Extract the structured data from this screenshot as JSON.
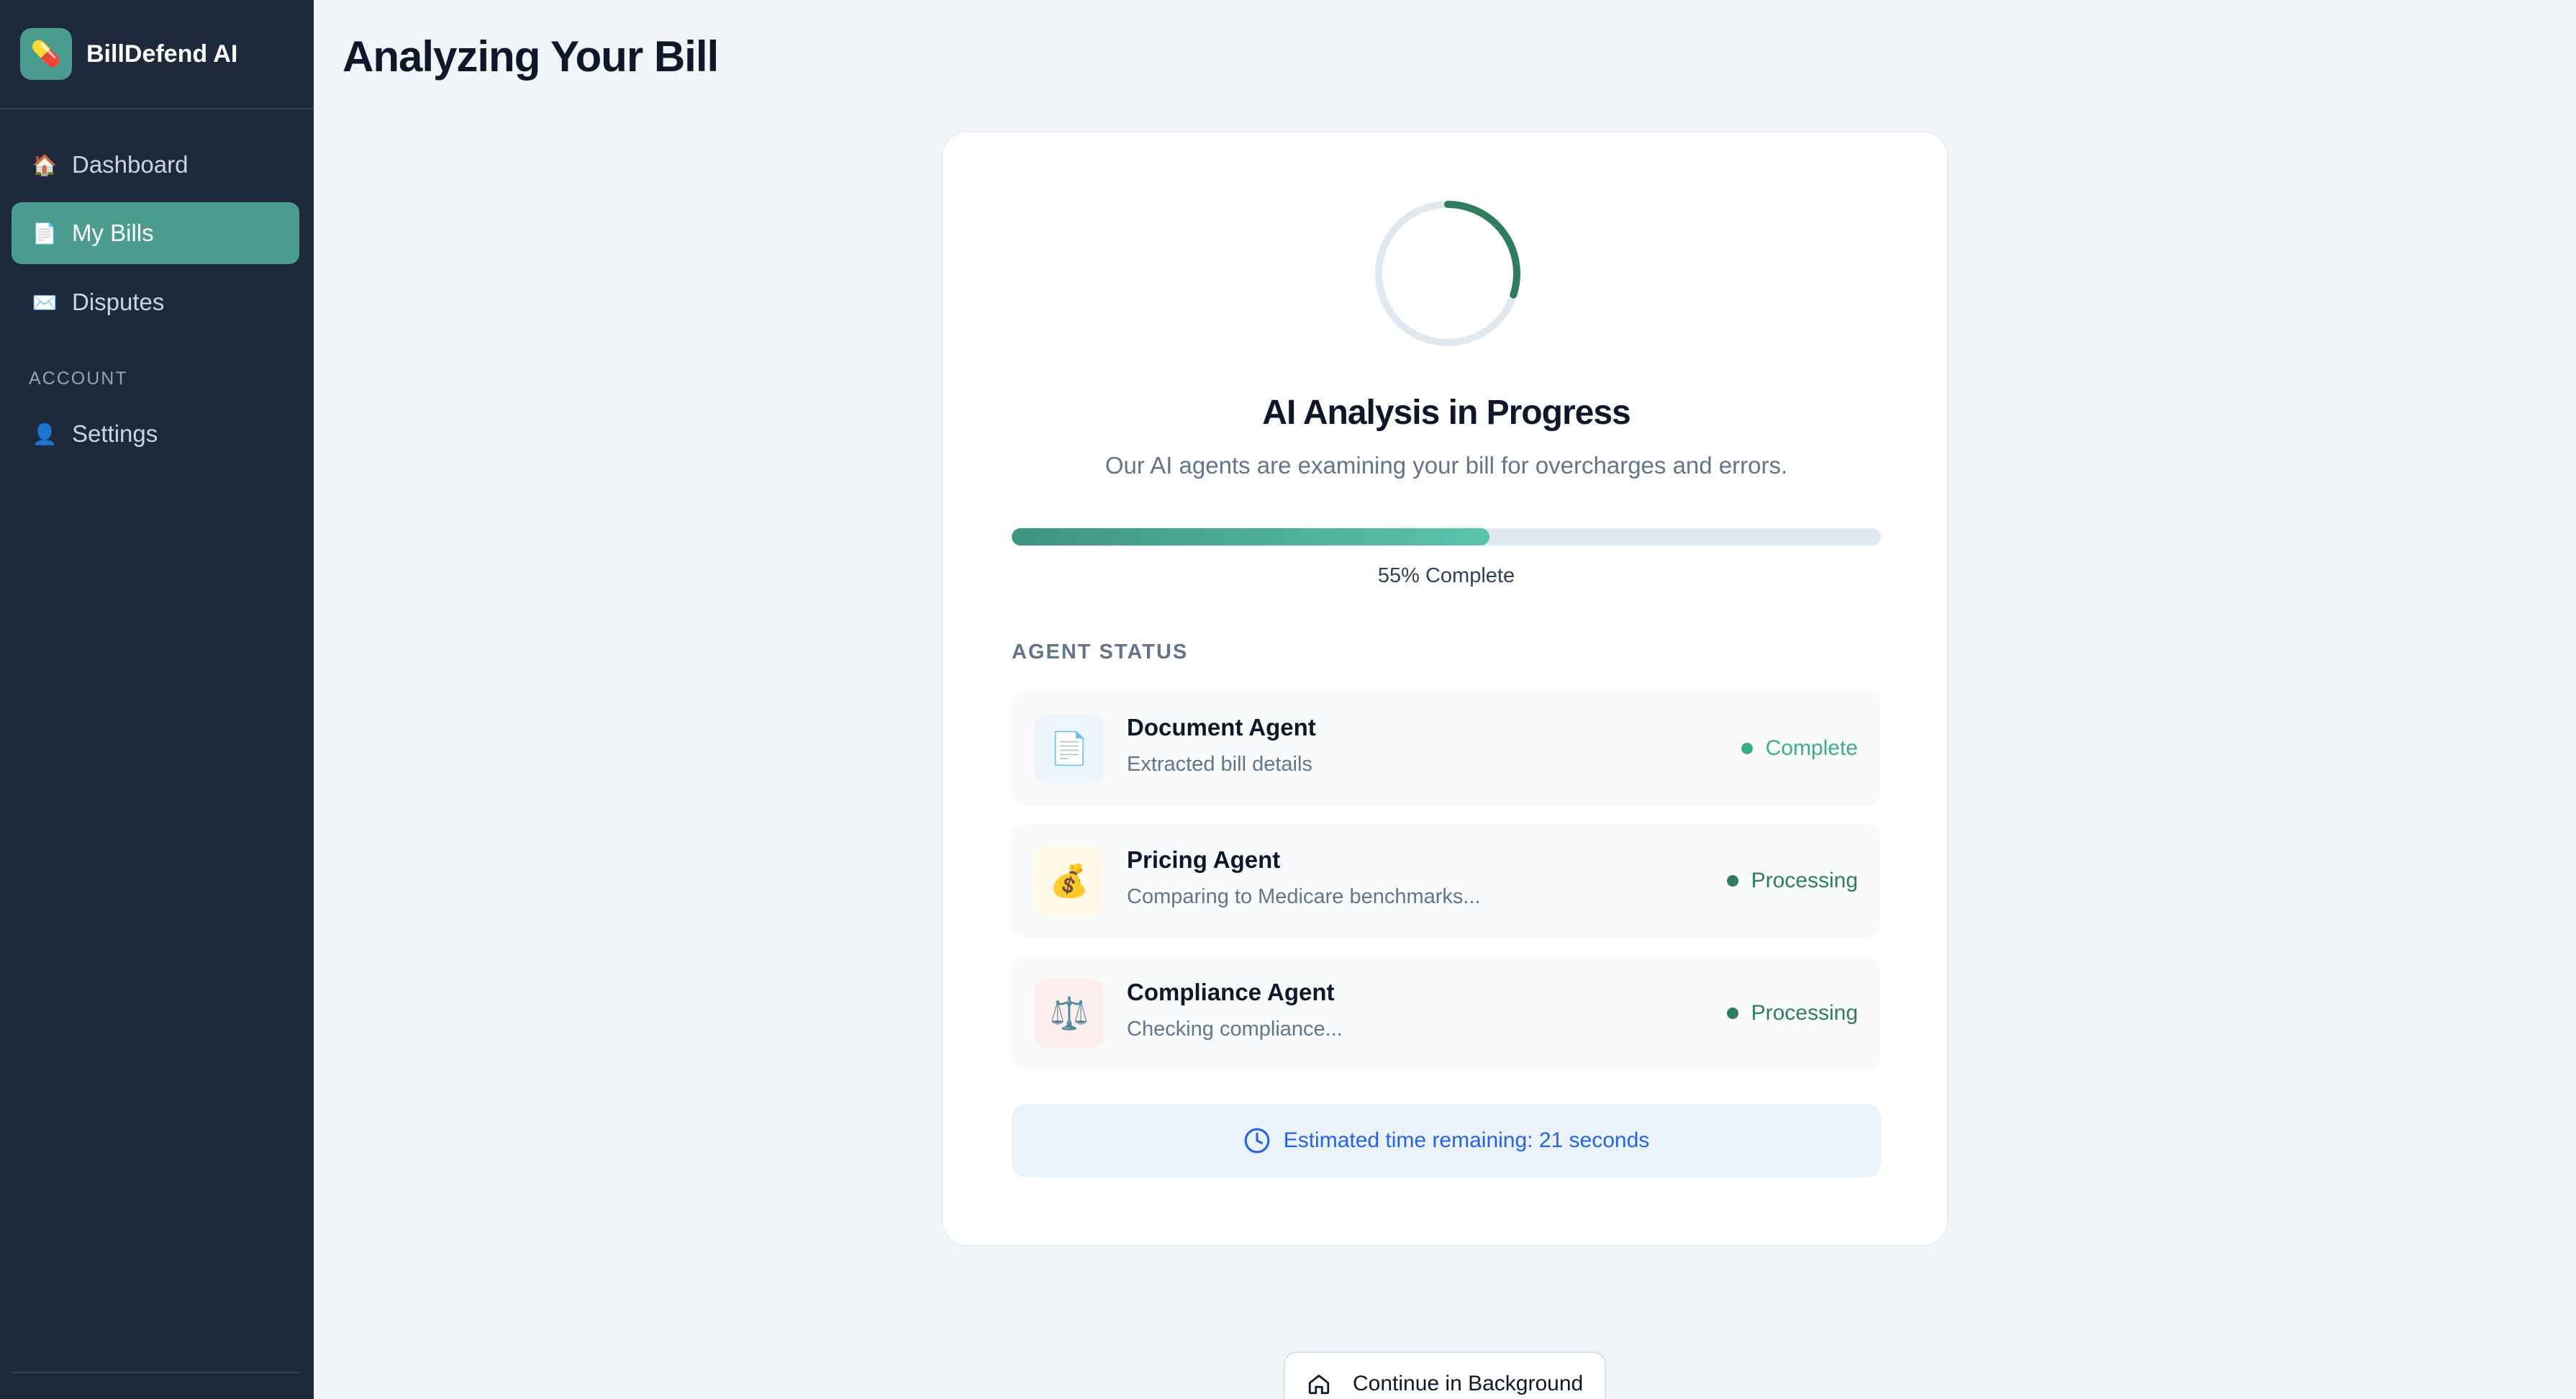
{
  "app": {
    "name": "BillDefend AI",
    "logo_emoji": "💊"
  },
  "sidebar": {
    "items": [
      {
        "label": "Dashboard",
        "icon": "🏠",
        "active": false
      },
      {
        "label": "My Bills",
        "icon": "📄",
        "active": true
      },
      {
        "label": "Disputes",
        "icon": "✉️",
        "active": false
      }
    ],
    "section_label": "ACCOUNT",
    "account_items": [
      {
        "label": "Settings",
        "icon": "👤"
      }
    ]
  },
  "page": {
    "title": "Analyzing Your Bill"
  },
  "analysis": {
    "title": "AI Analysis in Progress",
    "subtitle": "Our AI agents are examining your bill for overcharges and errors.",
    "progress_fraction": 0.55,
    "progress_label": "55% Complete",
    "spinner_fraction": 0.3,
    "section_heading": "AGENT STATUS",
    "agents": [
      {
        "name": "Document Agent",
        "description": "Extracted bill details",
        "status": "Complete",
        "icon": "📄",
        "icon_bg": "#eef4fb",
        "status_color": "#3fae7e"
      },
      {
        "name": "Pricing Agent",
        "description": "Comparing to Medicare benchmarks...",
        "status": "Processing",
        "icon": "💰",
        "icon_bg": "#fff8e6",
        "status_color": "#2f7d5e"
      },
      {
        "name": "Compliance Agent",
        "description": "Checking compliance...",
        "status": "Processing",
        "icon": "⚖️",
        "icon_bg": "#fdeeee",
        "status_color": "#2f7d5e"
      }
    ],
    "eta_text": "Estimated time remaining: 21 seconds"
  },
  "actions": {
    "continue_label": "Continue in Background"
  },
  "colors": {
    "sidebar_bg": "#1e293b",
    "accent": "#4a9d8e",
    "page_bg": "#f1f4f8",
    "eta_text": "#2563eb"
  }
}
